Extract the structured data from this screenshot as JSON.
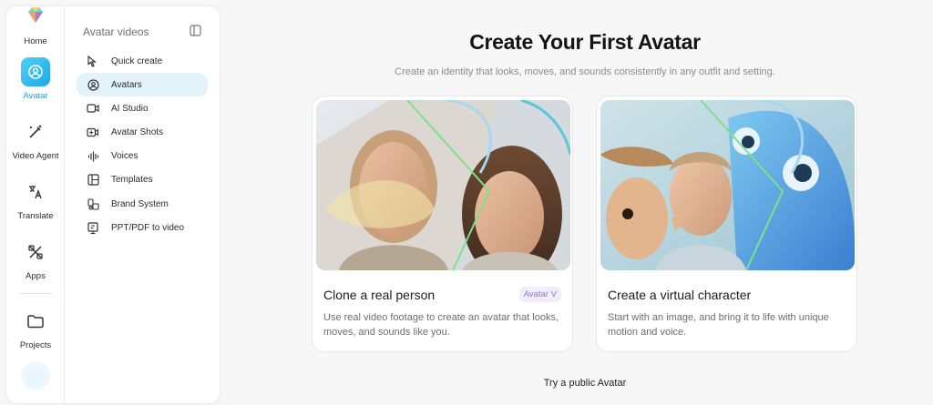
{
  "rail": {
    "items": [
      {
        "label": "Home",
        "icon": "home-logo-icon"
      },
      {
        "label": "Avatar",
        "icon": "avatar-icon",
        "active": true
      },
      {
        "label": "Video Agent",
        "icon": "magic-wand-icon"
      },
      {
        "label": "Translate",
        "icon": "translate-icon"
      },
      {
        "label": "Apps",
        "icon": "apps-icon"
      },
      {
        "label": "Projects",
        "icon": "folder-icon"
      }
    ]
  },
  "panel": {
    "title": "Avatar videos",
    "items": [
      {
        "label": "Quick create",
        "icon": "cursor-icon"
      },
      {
        "label": "Avatars",
        "icon": "user-circle-icon",
        "active": true
      },
      {
        "label": "AI Studio",
        "icon": "video-camera-icon"
      },
      {
        "label": "Avatar Shots",
        "icon": "video-plus-icon"
      },
      {
        "label": "Voices",
        "icon": "waveform-icon"
      },
      {
        "label": "Templates",
        "icon": "layout-icon"
      },
      {
        "label": "Brand System",
        "icon": "brand-icon"
      },
      {
        "label": "PPT/PDF to video",
        "icon": "presentation-icon"
      }
    ]
  },
  "main": {
    "title": "Create Your First Avatar",
    "subtitle": "Create an identity that looks, moves, and sounds consistently in any outfit and setting.",
    "cards": [
      {
        "title": "Clone a real person",
        "badge": "Avatar V",
        "description": "Use real video footage to create an avatar that looks, moves, and sounds like you."
      },
      {
        "title": "Create a virtual character",
        "description": "Start with an image, and bring it to life with unique motion and voice."
      }
    ],
    "public_link": "Try a public Avatar"
  },
  "colors": {
    "accent": "#1fa8e6",
    "active_bg": "#e4f3fb",
    "badge_text": "#8e74d9",
    "badge_bg": "#f1edfd"
  }
}
